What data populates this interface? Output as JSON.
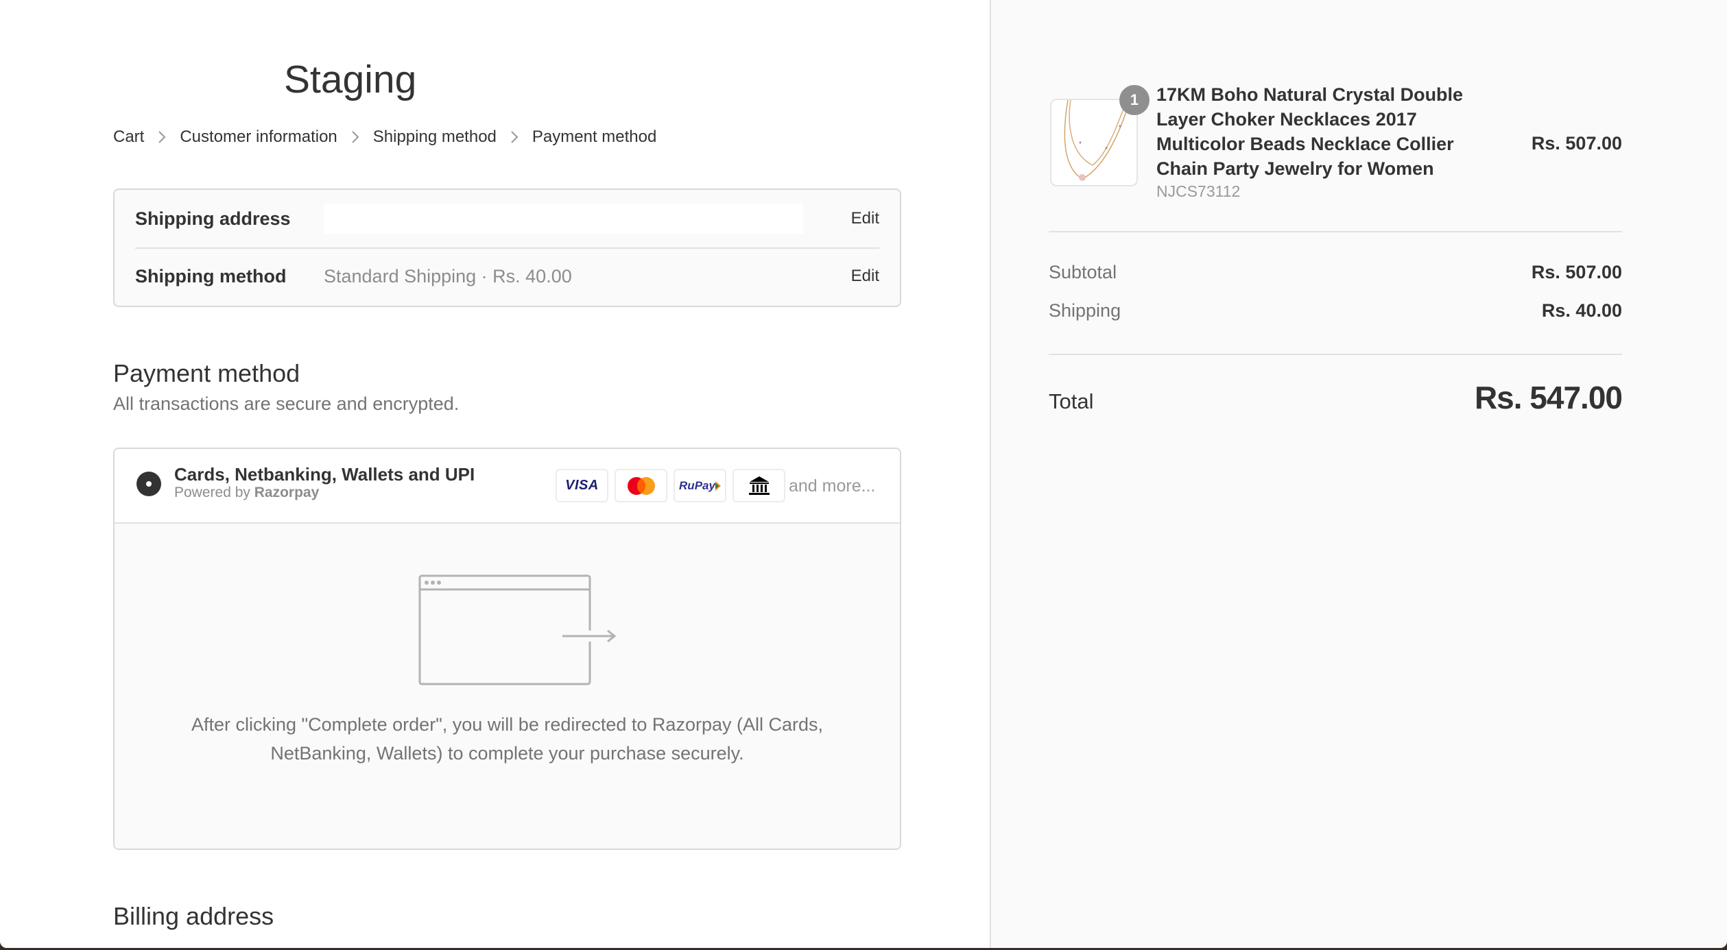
{
  "store": {
    "title": "Staging"
  },
  "breadcrumb": {
    "items": [
      {
        "label": "Cart"
      },
      {
        "label": "Customer information"
      },
      {
        "label": "Shipping method"
      },
      {
        "label": "Payment method"
      }
    ]
  },
  "review": {
    "shipping_address": {
      "label": "Shipping address",
      "value": "",
      "edit_label": "Edit"
    },
    "shipping_method": {
      "label": "Shipping method",
      "value": "Standard Shipping · Rs. 40.00",
      "edit_label": "Edit"
    }
  },
  "payment": {
    "title": "Payment method",
    "subtitle": "All transactions are secure and encrypted.",
    "option": {
      "label": "Cards, Netbanking, Wallets and UPI",
      "powered_prefix": "Powered by",
      "powered_brand": "Razorpay",
      "selected": true,
      "icons": [
        {
          "name": "visa-icon",
          "text": "VISA"
        },
        {
          "name": "mastercard-icon",
          "text": ""
        },
        {
          "name": "rupay-icon",
          "text": "RuPay"
        },
        {
          "name": "bank-icon",
          "text": ""
        }
      ],
      "and_more": "and more..."
    },
    "redirect_text": "After clicking \"Complete order\", you will be redirected to Razorpay (All Cards, NetBanking, Wallets) to complete your purchase securely."
  },
  "billing": {
    "title": "Billing address"
  },
  "order_summary": {
    "product": {
      "quantity": "1",
      "name": "17KM Boho Natural Crystal Double Layer Choker Necklaces 2017 Multicolor Beads Necklace Collier Chain Party Jewelry for Women",
      "sku": "NJCS73112",
      "price": "Rs. 507.00"
    },
    "subtotal": {
      "label": "Subtotal",
      "value": "Rs. 507.00"
    },
    "shipping": {
      "label": "Shipping",
      "value": "Rs. 40.00"
    },
    "total": {
      "label": "Total",
      "value": "Rs. 547.00"
    }
  },
  "colors": {
    "text": "#333333",
    "muted": "#737373",
    "sidebar_bg": "#fafafa",
    "border": "#d9d9d9",
    "visa": "#1a1f71",
    "mastercard_red": "#eb001b",
    "mastercard_orange": "#f79e1b"
  }
}
